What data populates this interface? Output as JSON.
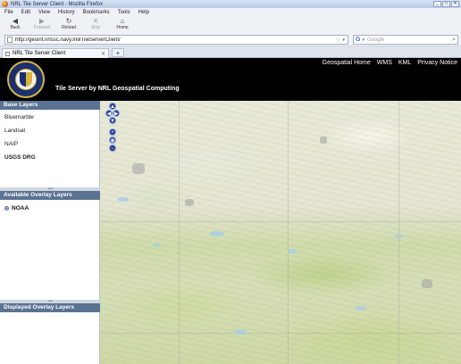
{
  "browser": {
    "window_title": "NRL Tile Server Client - Mozilla Firefox",
    "window_controls": [
      "_",
      "□",
      "✕"
    ],
    "menu": [
      "File",
      "Edit",
      "View",
      "History",
      "Bookmarks",
      "Tools",
      "Help"
    ],
    "toolbar": [
      {
        "label": "Back",
        "icon": "back-arrow-icon",
        "glyph": "◀"
      },
      {
        "label": "Forward",
        "icon": "forward-arrow-icon",
        "glyph": "▶"
      },
      {
        "label": "Reload",
        "icon": "reload-icon",
        "glyph": "↻"
      },
      {
        "label": "Stop",
        "icon": "stop-icon",
        "glyph": "✕"
      },
      {
        "label": "Home",
        "icon": "home-icon",
        "glyph": "⌂"
      }
    ],
    "url": "http://geoint.nrlssc.navy.mil/TileServerClient/",
    "search_placeholder": "Google",
    "tab_title": "NRL Tile Server Client",
    "new_tab": "+"
  },
  "site": {
    "title": "Tile Server by NRL Geospatial Computing",
    "nav": [
      "Geospatial Home",
      "WMS",
      "KML",
      "Privacy Notice"
    ]
  },
  "sidebar": {
    "base_layers_header": "Base Layers",
    "base_layers": [
      "Bluemarble",
      "Landsat",
      "NAIP",
      "USGS DRG"
    ],
    "selected_base_layer": "USGS DRG",
    "overlay_header": "Available Overlay Layers",
    "overlays": [
      "NOAA"
    ],
    "displayed_header": "Displayed Overlay Layers"
  },
  "map_controls": {
    "pan_up": "▲",
    "pan_down": "▼",
    "pan_left": "◀",
    "pan_right": "▶",
    "zoom_in": "+",
    "zoom_world": "◉",
    "zoom_out": "−"
  },
  "colors": {
    "panel_header": "#5b7392",
    "header_bg": "#000000",
    "map_control": "#1e3a9a"
  }
}
